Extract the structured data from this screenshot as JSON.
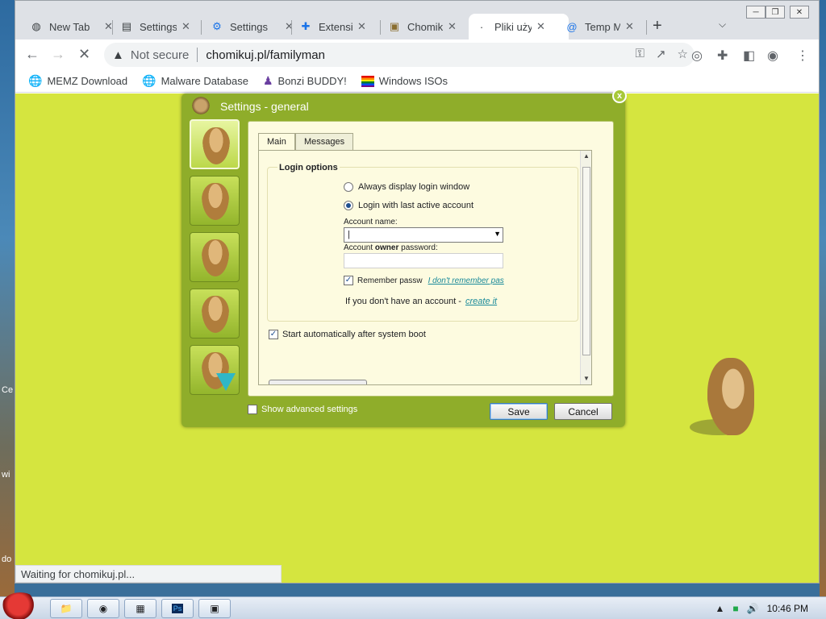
{
  "desktop": {
    "side_labels": [
      "Ce",
      "wi",
      "do"
    ]
  },
  "browser": {
    "tabs": [
      {
        "label": "New Tab",
        "icon": "chrome-icon",
        "glyph": "◍"
      },
      {
        "label": "Settings",
        "icon": "page-icon",
        "glyph": "▤"
      },
      {
        "label": "Settings",
        "icon": "gear-icon",
        "glyph": "⚙"
      },
      {
        "label": "Extensions",
        "icon": "puzzle-icon",
        "glyph": "✚"
      },
      {
        "label": "Chomikuj",
        "icon": "hamster-favicon",
        "glyph": "▣"
      },
      {
        "label": "Pliki użytkownika",
        "icon": "loading-icon",
        "glyph": "·"
      },
      {
        "label": "Temp Mail",
        "icon": "at-icon",
        "glyph": "@"
      }
    ],
    "close_glyph": "✕",
    "new_tab_glyph": "+",
    "address": {
      "security_label": "Not secure",
      "url": "chomikuj.pl/familyman"
    },
    "bookmarks": [
      {
        "label": "MEMZ Download",
        "icon": "globe-icon"
      },
      {
        "label": "Malware Database",
        "icon": "globe-icon"
      },
      {
        "label": "Bonzi BUDDY!",
        "icon": "bonzi-icon"
      },
      {
        "label": "Windows ISOs",
        "icon": "rainbow-flag-icon"
      }
    ],
    "status_text": "Waiting for chomikuj.pl..."
  },
  "dialog": {
    "title": "Settings - general",
    "close_label": "x",
    "tabs": [
      "Main",
      "Messages"
    ],
    "login_group_title": "Login options",
    "radio_always": "Always display login window",
    "radio_last": "Login with last active account",
    "account_name_label": "Account name:",
    "account_owner_label_pre": "Account ",
    "account_owner_label_bold": "owner",
    "account_owner_label_post": " password:",
    "account_name_value": "|",
    "remember_label": "Remember passw",
    "forgot_link": "I don't remember pas",
    "no_account_text": "If you don't have an account - ",
    "create_link": "create it",
    "autostart_label": "Start automatically after system boot",
    "advanced_label": "Show advanced settings",
    "save_label": "Save",
    "cancel_label": "Cancel"
  },
  "taskbar": {
    "clock": "10:46 PM"
  }
}
